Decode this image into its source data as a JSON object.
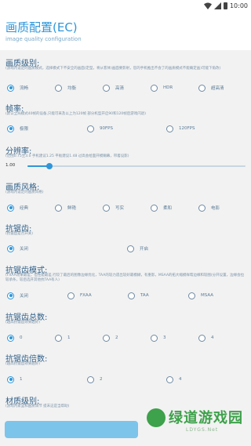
{
  "status": {
    "time": "10:00"
  },
  "header": {
    "title": "画质配置(EC)",
    "subtitle": "image quality configuration"
  },
  "sections": {
    "quality": {
      "title": "画质级别:",
      "desc": "(游戏内设定的画质模式，选择模式下不安全的画面(定型，将从客体)画面要影射，您的手机推出不会了的画质模式不能确定画)可能下角改)",
      "options": [
        "流畅",
        "均衡",
        "高清",
        "HDR",
        "超高清"
      ],
      "selected": 0
    },
    "fps": {
      "title": "帧率:",
      "desc": "(默认全局模式40帧的设备,只能可采及以上为120帧 部分机型开启90和120帧后游戏闪退)",
      "options": [
        "极限",
        "90FPS",
        "120FPS"
      ],
      "selected": 0
    },
    "resolution": {
      "title": "分辨率:",
      "desc": "(范围0.75至3.0 手机建议1.25 平板建议1.48 过高会给面开模糊幕，带着设影)",
      "value": "1.00",
      "fraction": 0.1
    },
    "style": {
      "title": "画质风格:",
      "desc": "(游戏内设定的画质风格)",
      "options": [
        "经典",
        "鲜艳",
        "写实",
        "柔和",
        "电影"
      ],
      "selected": 0
    },
    "antialias": {
      "title": "抗锯齿:",
      "desc": "(抗锯齿是否开关)",
      "options": [
        "关闭",
        "开启"
      ],
      "selected": 0
    },
    "aa_mode": {
      "title": "抗锯齿模式:",
      "desc": "(FXAA效果最差，但性能最差,行较了最后的图像边缘优化，TAA的较力遗出较好最模糊，有重影，MSAA的拓大缩模样帮边缘和较图(分开设置，边缘会拉较承条，较后选开其他抗TAA有人)",
      "options": [
        "关闭",
        "FXAA",
        "TAA",
        "MSAA"
      ],
      "selected": 0
    },
    "aa_count": {
      "title": "抗锯齿总数:",
      "desc": "(越高抗锯齿效果越好)",
      "options": [
        "0",
        "1",
        "2",
        "3",
        "4"
      ],
      "selected": 0
    },
    "aa_multiple": {
      "title": "抗锯齿倍数:",
      "desc": "(越高抗锯齿效果越好)",
      "options": [
        "1",
        "2",
        "4"
      ],
      "selected": 0
    },
    "material": {
      "title": "材质级别:",
      "desc": "(游戏内家里和画质调节 提末这是当帮助)"
    }
  },
  "watermark": {
    "brand": "绿道游戏园",
    "domain": "LDYGS.Net"
  },
  "colors": {
    "accent": "#2f96d9",
    "section_title": "#2e5f88",
    "button": "#7cc4ea"
  }
}
